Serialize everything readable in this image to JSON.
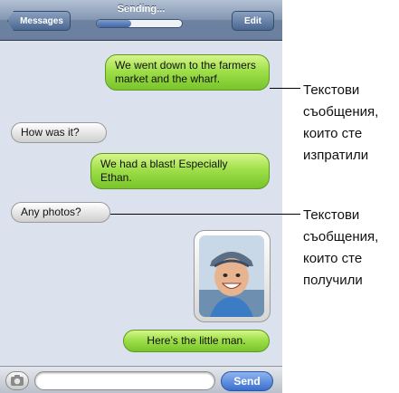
{
  "navbar": {
    "back_label": "Messages",
    "title": "Sending...",
    "edit_label": "Edit",
    "progress": 0.4
  },
  "messages": [
    {
      "type": "sent",
      "text": "We went down to the farmers market and the wharf."
    },
    {
      "type": "received",
      "text": "How was it?"
    },
    {
      "type": "sent",
      "text": "We had a blast! Especially Ethan."
    },
    {
      "type": "received",
      "text": "Any photos?"
    },
    {
      "type": "sent-photo"
    },
    {
      "type": "sent",
      "text": "Here’s the little man."
    }
  ],
  "input": {
    "placeholder": "",
    "send_label": "Send"
  },
  "callouts": {
    "sent_label": "Текстови съобщения, които сте изпратили",
    "received_label": "Текстови съобщения, които сте получили"
  },
  "colors": {
    "sent_bubble": "#9fe04a",
    "received_bubble": "#e6e6e6",
    "background": "#dbe2ed",
    "send_button": "#3a6fd0"
  }
}
